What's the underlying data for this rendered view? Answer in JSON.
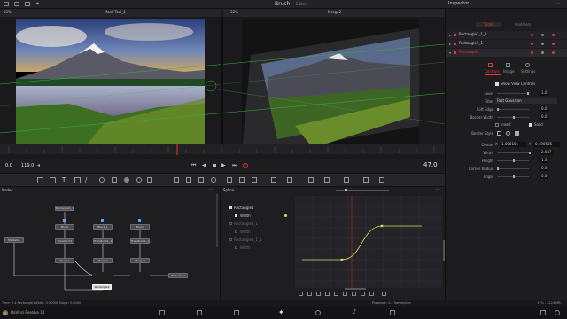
{
  "app": {
    "title": "Brush",
    "title_status": "Edited",
    "name": "DaVinci Resolve 18"
  },
  "colors": {
    "accent_red": "#e0392b",
    "spline_curve": "#d9d96a",
    "node_link": "#d9d9d9",
    "guide_green": "#3fae3f"
  },
  "viewer": {
    "left_title": "Mask Tool_1",
    "right_title": "Merge2",
    "zoom_left": "33%",
    "zoom_right": "32%",
    "frame_current": "0.0",
    "frame_end": "119.0",
    "frame_readout": "47.0"
  },
  "spline": {
    "title": "Spline",
    "tree": [
      {
        "label": "Rectangle1",
        "checked": true
      },
      {
        "label": "Width",
        "checked": true
      },
      {
        "label": "Rectangle1_1",
        "checked": false
      },
      {
        "label": "Width",
        "checked": false
      },
      {
        "label": "Rectangle1_1_1",
        "checked": false
      },
      {
        "label": "Width",
        "checked": false
      }
    ],
    "curve": {
      "keyframes": [
        {
          "frame": 0,
          "value": 0.0
        },
        {
          "frame": 30,
          "value": 0.0
        },
        {
          "frame": 60,
          "value": 2.047
        },
        {
          "frame": 90,
          "value": 2.047
        }
      ]
    }
  },
  "nodes": {
    "title": "Nodes",
    "items": [
      "Rectangle1_1",
      "Blur2",
      "Blur1_1",
      "Blur1",
      "Transform1",
      "Transform1_1",
      "Transform1_1_1",
      "Merge1",
      "Merge2",
      "Merge3",
      "MediaIn1",
      "MediaOut1",
      "Rectangle1"
    ]
  },
  "inspector": {
    "title": "Inspector",
    "tabs": [
      "Tools",
      "Modifiers"
    ],
    "tool_items": [
      "Rectangle1_1_1",
      "Rectangle1_1",
      "Rectangle1"
    ],
    "subtabs": [
      "Controls",
      "Image",
      "Settings"
    ],
    "show_view_controls": "Show View Controls",
    "controls": {
      "level": {
        "label": "Level",
        "value": "1.0"
      },
      "filter": {
        "label": "Filter",
        "value": "Fast Gaussian"
      },
      "soft_edge": {
        "label": "Soft Edge",
        "value": "0.0"
      },
      "border_width": {
        "label": "Border Width",
        "value": "0.0"
      },
      "invert": "Invert",
      "solid": "Solid",
      "border_style": {
        "label": "Border Style"
      },
      "center": {
        "label": "Center",
        "x_label": "X",
        "x_value": "1.008101",
        "y_label": "Y",
        "y_value": "0.490505"
      },
      "width": {
        "label": "Width",
        "value": "2.047"
      },
      "height": {
        "label": "Height",
        "value": "1.0"
      },
      "corner_radius": {
        "label": "Corner Radius",
        "value": "0.0"
      },
      "angle": {
        "label": "Angle",
        "value": "0.0"
      }
    }
  },
  "status": {
    "left": "Time: 0.4   Rectangle1Width: 0.0000L   Slope: 0.0000",
    "right": "Playback: 4.4 frames/sec",
    "mem": "11% - 3224 MB"
  }
}
